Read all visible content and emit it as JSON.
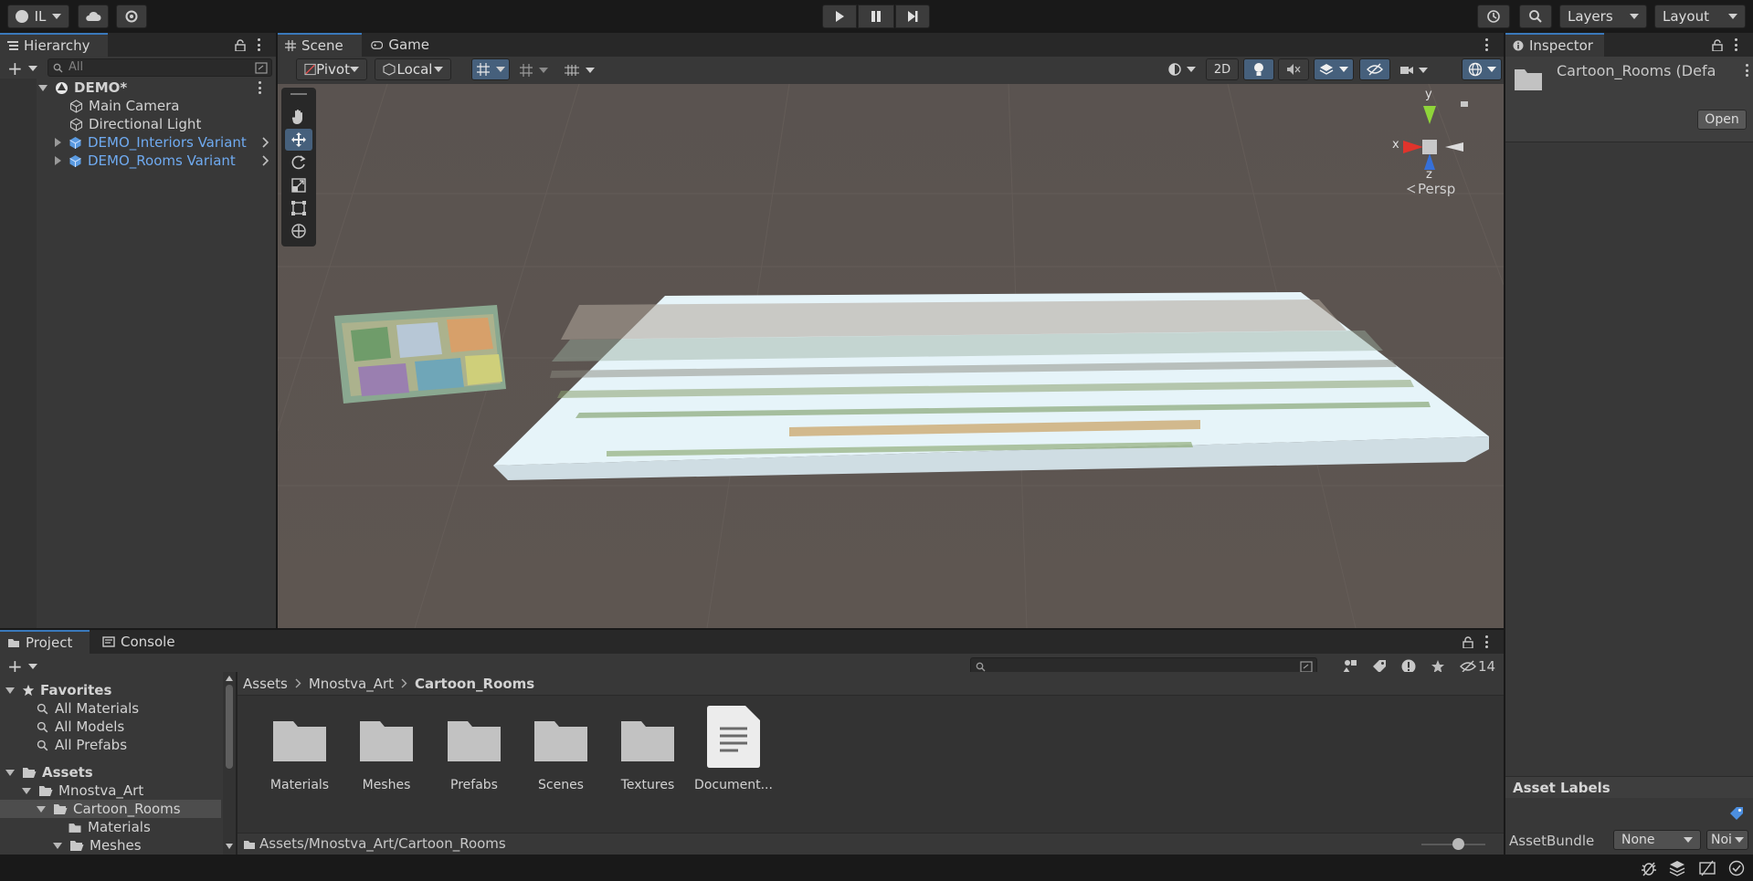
{
  "toolbar": {
    "account_label": "IL",
    "layers_label": "Layers",
    "layout_label": "Layout"
  },
  "hierarchy": {
    "tab_label": "Hierarchy",
    "search_placeholder": "All",
    "scene_name": "DEMO*",
    "items": [
      {
        "label": "Main Camera"
      },
      {
        "label": "Directional Light"
      },
      {
        "label": "DEMO_Interiors Variant"
      },
      {
        "label": "DEMO_Rooms Variant"
      }
    ]
  },
  "scene_view": {
    "tabs": [
      {
        "label": "Scene"
      },
      {
        "label": "Game"
      }
    ],
    "pivot_label": "Pivot",
    "local_label": "Local",
    "mode_2d_label": "2D",
    "gizmo": {
      "x_label": "x",
      "y_label": "y",
      "z_label": "z",
      "projection_label": "Persp"
    }
  },
  "inspector": {
    "tab_label": "Inspector",
    "asset_name": "Cartoon_Rooms (Defa",
    "open_label": "Open",
    "asset_labels_title": "Asset Labels",
    "assetbundle_label": "AssetBundle",
    "assetbundle_value": "None",
    "assetbundle_variant": "Noi"
  },
  "project": {
    "tabs": [
      {
        "label": "Project"
      },
      {
        "label": "Console"
      }
    ],
    "hidden_count": "14",
    "favorites_label": "Favorites",
    "favorites": [
      {
        "label": "All Materials"
      },
      {
        "label": "All Models"
      },
      {
        "label": "All Prefabs"
      }
    ],
    "tree": [
      {
        "label": "Assets"
      },
      {
        "label": "Mnostva_Art"
      },
      {
        "label": "Cartoon_Rooms"
      },
      {
        "label": "Materials"
      },
      {
        "label": "Meshes"
      }
    ],
    "breadcrumb": [
      {
        "label": "Assets"
      },
      {
        "label": "Mnostva_Art"
      },
      {
        "label": "Cartoon_Rooms"
      }
    ],
    "grid_items": [
      {
        "label": "Materials"
      },
      {
        "label": "Meshes"
      },
      {
        "label": "Prefabs"
      },
      {
        "label": "Scenes"
      },
      {
        "label": "Textures"
      },
      {
        "label": "Document..."
      }
    ],
    "path": "Assets/Mnostva_Art/Cartoon_Rooms"
  },
  "colors": {
    "accent": "#3a79bb",
    "selection": "#46607c",
    "prefab_blue": "#6faaf0"
  }
}
